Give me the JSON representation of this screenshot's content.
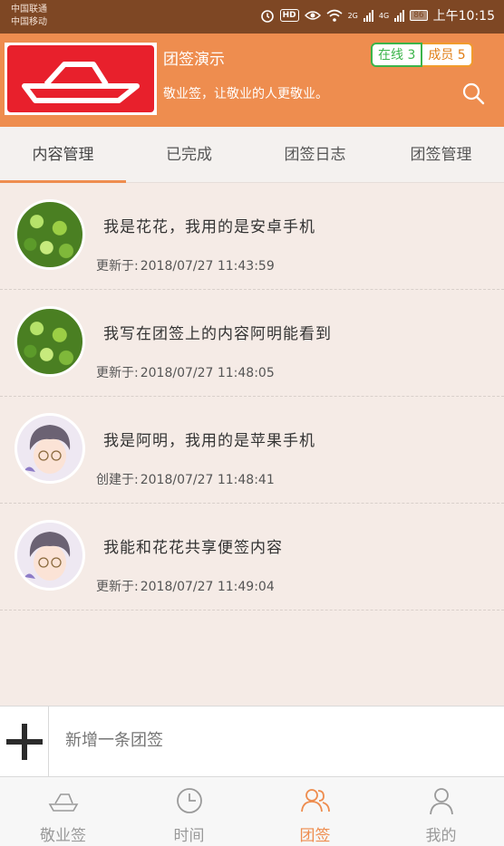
{
  "status": {
    "carrier_1": "中国联通",
    "carrier_2": "中国移动",
    "net_1": "2G",
    "net_2": "4G",
    "battery": "86",
    "time": "上午10:15"
  },
  "header": {
    "group_name": "团签演示",
    "slogan": "敬业签，让敬业的人更敬业。",
    "online_label": "在线 3",
    "members_label": "成员 5",
    "colors": {
      "header_bg": "#ee8d4f",
      "online": "#3bb44a",
      "members": "#f19b2c",
      "logo_bg": "#e8202c"
    }
  },
  "tabs": [
    {
      "label": "内容管理",
      "active": true
    },
    {
      "label": "已完成",
      "active": false
    },
    {
      "label": "团签日志",
      "active": false
    },
    {
      "label": "团签管理",
      "active": false
    }
  ],
  "items": [
    {
      "avatar": "leaf-avatar",
      "text": "我是花花，我用的是安卓手机",
      "date_label": "更新于:",
      "date": "2018/07/27  11:43:59"
    },
    {
      "avatar": "leaf-avatar",
      "text": "我写在团签上的内容阿明能看到",
      "date_label": "更新于:",
      "date": "2018/07/27  11:48:05"
    },
    {
      "avatar": "boy-avatar",
      "text": "我是阿明，我用的是苹果手机",
      "date_label": "创建于:",
      "date": "2018/07/27  11:48:41"
    },
    {
      "avatar": "boy-avatar",
      "text": "我能和花花共享便签内容",
      "date_label": "更新于:",
      "date": "2018/07/27  11:49:04"
    }
  ],
  "add_bar": {
    "placeholder": "新增一条团签",
    "icon": "plus-icon"
  },
  "nav": [
    {
      "label": "敬业签",
      "icon": "cloud-logo-icon",
      "active": false
    },
    {
      "label": "时间",
      "icon": "clock-icon",
      "active": false
    },
    {
      "label": "团签",
      "icon": "group-icon",
      "active": true
    },
    {
      "label": "我的",
      "icon": "person-icon",
      "active": false
    }
  ]
}
